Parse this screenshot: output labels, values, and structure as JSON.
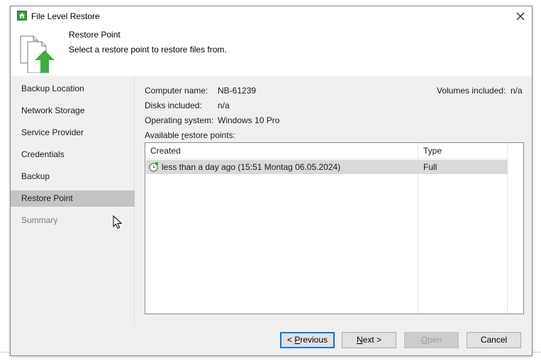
{
  "window": {
    "title": "File Level Restore",
    "close_symbol": "✕"
  },
  "header": {
    "title": "Restore Point",
    "subtitle": "Select a restore point to restore files from.",
    "icon": "restore-document-arrow-icon"
  },
  "sidebar": {
    "items": [
      {
        "label": "Backup Location",
        "state": "normal"
      },
      {
        "label": "Network Storage",
        "state": "normal"
      },
      {
        "label": "Service Provider",
        "state": "normal"
      },
      {
        "label": "Credentials",
        "state": "normal"
      },
      {
        "label": "Backup",
        "state": "normal"
      },
      {
        "label": "Restore Point",
        "state": "active"
      },
      {
        "label": "Summary",
        "state": "disabled"
      }
    ]
  },
  "details": {
    "computer_name_label": "Computer name:",
    "computer_name_value": "NB-61239",
    "disks_label": "Disks included:",
    "disks_value": "n/a",
    "os_label": "Operating system:",
    "os_value": "Windows 10 Pro",
    "volumes_label": "Volumes included:",
    "volumes_value": "n/a",
    "available_label_pre": "Available ",
    "available_label_key": "r",
    "available_label_post": "estore points:"
  },
  "restore_points": {
    "columns": [
      "Created",
      "Type"
    ],
    "rows": [
      {
        "created": "less than a day ago (15:51 Montag 06.05.2024)",
        "type": "Full",
        "selected": true
      }
    ]
  },
  "buttons": {
    "previous_pre": "< ",
    "previous_key": "P",
    "previous_post": "revious",
    "next_key": "N",
    "next_post": "ext >",
    "open_key": "O",
    "open_post": "pen",
    "cancel": "Cancel"
  },
  "colors": {
    "accent": "#0078d7",
    "brand_green": "#3a9a3a",
    "selection": "#d9d9d9",
    "sidebar_active": "#c4c4c4"
  }
}
